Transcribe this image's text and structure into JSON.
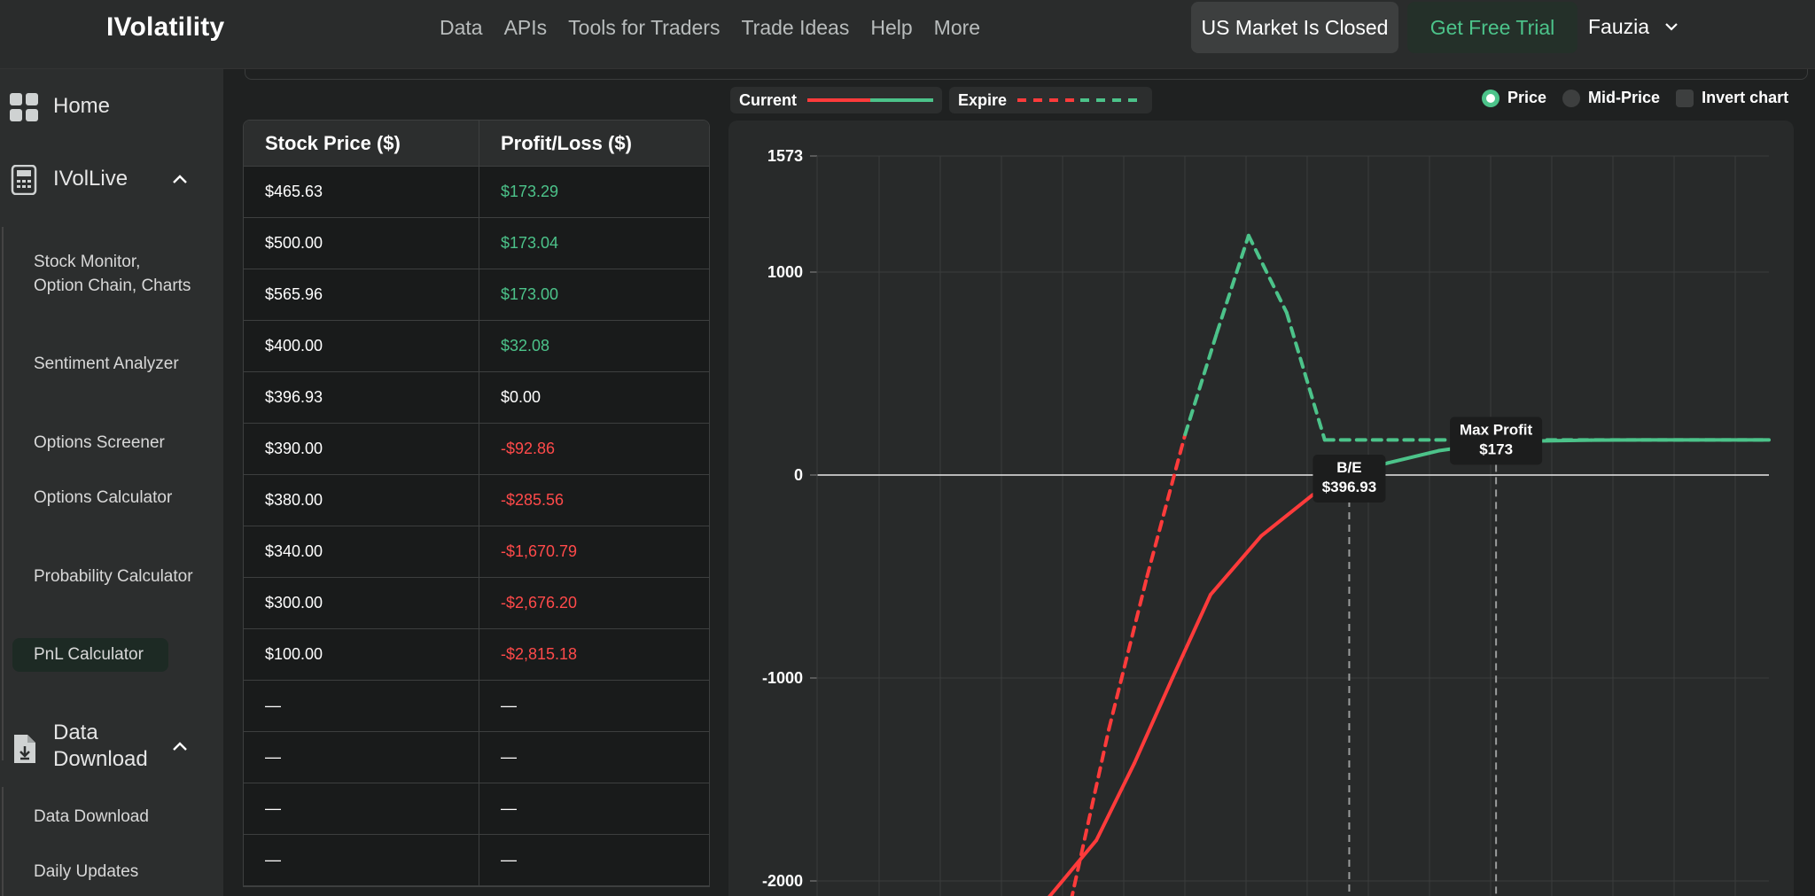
{
  "header": {
    "logo": "IVolatility",
    "nav": [
      "Data",
      "APIs",
      "Tools for Traders",
      "Trade Ideas",
      "Help",
      "More"
    ],
    "market_status": "US Market Is Closed",
    "trial_label": "Get Free Trial",
    "user_name": "Fauzia"
  },
  "sidebar": {
    "home_label": "Home",
    "ivollive_label": "IVolLive",
    "ivollive_items": [
      {
        "label": "Stock Monitor, Option Chain, Charts"
      },
      {
        "label": "Sentiment Analyzer"
      },
      {
        "label": "Options Screener"
      },
      {
        "label": "Options Calculator"
      },
      {
        "label": "Probability Calculator"
      },
      {
        "label": "PnL Calculator"
      }
    ],
    "data_download_label": "Data Download",
    "data_download_items": [
      {
        "label": "Data Download"
      },
      {
        "label": "Daily Updates"
      }
    ]
  },
  "table": {
    "headers": [
      "Stock Price ($)",
      "Profit/Loss ($)"
    ],
    "rows": [
      {
        "price": "$465.63",
        "pnl": "$173.29",
        "sign": "pos"
      },
      {
        "price": "$500.00",
        "pnl": "$173.04",
        "sign": "pos"
      },
      {
        "price": "$565.96",
        "pnl": "$173.00",
        "sign": "pos"
      },
      {
        "price": "$400.00",
        "pnl": "$32.08",
        "sign": "pos"
      },
      {
        "price": "$396.93",
        "pnl": "$0.00",
        "sign": "zero"
      },
      {
        "price": "$390.00",
        "pnl": "-$92.86",
        "sign": "neg"
      },
      {
        "price": "$380.00",
        "pnl": "-$285.56",
        "sign": "neg"
      },
      {
        "price": "$340.00",
        "pnl": "-$1,670.79",
        "sign": "neg"
      },
      {
        "price": "$300.00",
        "pnl": "-$2,676.20",
        "sign": "neg"
      },
      {
        "price": "$100.00",
        "pnl": "-$2,815.18",
        "sign": "neg"
      },
      {
        "price": "—",
        "pnl": "—",
        "sign": "zero"
      },
      {
        "price": "—",
        "pnl": "—",
        "sign": "zero"
      },
      {
        "price": "—",
        "pnl": "—",
        "sign": "zero"
      },
      {
        "price": "—",
        "pnl": "—",
        "sign": "zero"
      }
    ]
  },
  "legend": {
    "current_label": "Current",
    "expire_label": "Expire"
  },
  "options": {
    "price_label": "Price",
    "mid_price_label": "Mid-Price",
    "invert_label": "Invert chart",
    "selected": "Price"
  },
  "chart_data": {
    "type": "line",
    "y_ticks": [
      "1573",
      "1000",
      "0",
      "-1000",
      "-2000"
    ],
    "ylim": [
      -2100,
      1573
    ],
    "xlim": [
      355,
      430
    ],
    "grid": true,
    "series": [
      {
        "name": "Current",
        "style": "solid",
        "x": [
          373,
          377,
          380,
          383,
          386,
          390,
          394,
          396.93,
          400,
          404,
          408,
          412,
          416,
          420,
          425,
          430
        ],
        "y": [
          -2100,
          -1800,
          -1420,
          -1000,
          -590,
          -300,
          -100,
          0,
          60,
          120,
          155,
          168,
          172,
          173,
          173,
          173
        ]
      },
      {
        "name": "Expire",
        "style": "dashed",
        "x": [
          375,
          378,
          381,
          384,
          386.5,
          389,
          392,
          395,
          400,
          410,
          420,
          430
        ],
        "y": [
          -2100,
          -1250,
          -500,
          200,
          700,
          1180,
          800,
          173,
          173,
          173,
          173,
          173
        ]
      }
    ],
    "annotations": [
      {
        "title": "B/E",
        "value": "$396.93",
        "x": 396.93
      },
      {
        "title": "Max Profit",
        "value": "$173",
        "x": 408.5
      }
    ],
    "colors": {
      "loss": "#ff3b3b",
      "profit": "#4cc38a"
    }
  }
}
